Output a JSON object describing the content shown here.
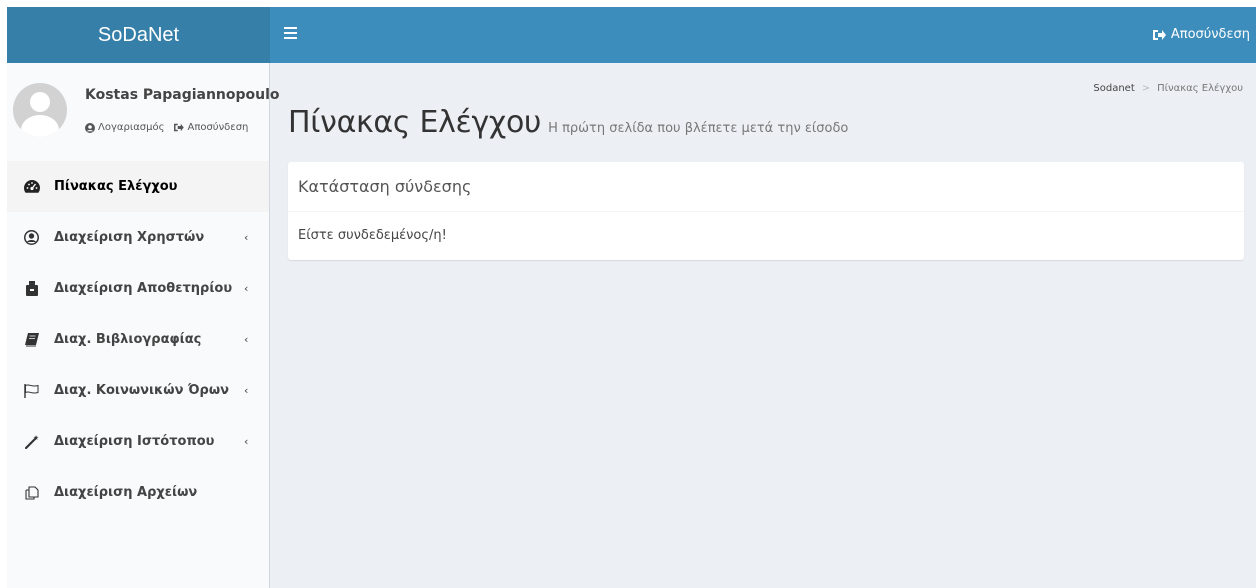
{
  "header": {
    "logo": "SoDaNet",
    "logout_label": "Αποσύνδεση"
  },
  "user": {
    "name": "Kostas Papagiannopoulo",
    "account_label": "Λογαριασμός",
    "logout_label": "Αποσύνδεση"
  },
  "sidebar": {
    "items": [
      {
        "label": "Πίνακας Ελέγχου",
        "icon": "dashboard-icon",
        "active": true,
        "has_children": false
      },
      {
        "label": "Διαχείριση Χρηστών",
        "icon": "user-circle-icon",
        "active": false,
        "has_children": true
      },
      {
        "label": "Διαχείριση Αποθετηρίου",
        "icon": "archive-icon",
        "active": false,
        "has_children": true
      },
      {
        "label": "Διαχ. Βιβλιογραφίας",
        "icon": "book-icon",
        "active": false,
        "has_children": true
      },
      {
        "label": "Διαχ. Κοινωνικών Όρων",
        "icon": "flag-icon",
        "active": false,
        "has_children": true
      },
      {
        "label": "Διαχείριση Ιστότοπου",
        "icon": "magic-wand-icon",
        "active": false,
        "has_children": true
      },
      {
        "label": "Διαχείριση Αρχείων",
        "icon": "files-icon",
        "active": false,
        "has_children": false
      }
    ],
    "chevron": "‹"
  },
  "breadcrumb": {
    "home": "Sodanet",
    "separator": ">",
    "current": "Πίνακας Ελέγχου"
  },
  "page": {
    "title": "Πίνακας Ελέγχου",
    "subtitle": "Η πρώτη σελίδα που βλέπετε μετά την είσοδο"
  },
  "box": {
    "title": "Κατάσταση σύνδεσης",
    "body": "Είστε συνδεδεμένος/η!"
  },
  "colors": {
    "header": "#3c8dbc",
    "logo_bg": "#367fa9",
    "sidebar_bg": "#f9fafc",
    "content_bg": "#ecf0f5"
  }
}
